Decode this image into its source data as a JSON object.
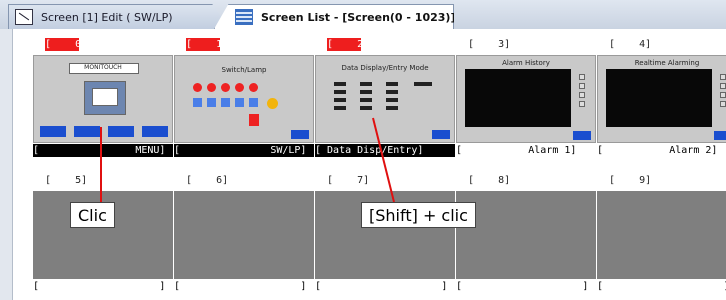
{
  "tabs": [
    {
      "label": "Screen [1] Edit (     SW/LP)"
    },
    {
      "label": "Screen List - [Screen(0 - 1023)]",
      "close": "×"
    }
  ],
  "screens": [
    {
      "number": "[    0]",
      "caption": "[                MENU]"
    },
    {
      "number": "[    1]",
      "caption": "[               SW/LP]"
    },
    {
      "number": "[    2]",
      "caption": "[ Data Disp/Entry]"
    },
    {
      "number": "[    3]",
      "caption": "[           Alarm 1]"
    },
    {
      "number": "[    4]",
      "caption": "[           Alarm 2]"
    },
    {
      "number": "[    5]",
      "caption": "[                    ]"
    },
    {
      "number": "[    6]",
      "caption": "[                    ]"
    },
    {
      "number": "[    7]",
      "caption": "[                    ]"
    },
    {
      "number": "[    8]",
      "caption": "[                    ]"
    },
    {
      "number": "[    9]",
      "caption": "[                    ]"
    }
  ],
  "thumbnails": {
    "menu_title": "MONITOUCH",
    "switch_title": "Switch/Lamp",
    "data_title": "Data Display/Entry Mode",
    "alarm_history_title": "Alarm History",
    "realtime_title": "Realtime Alarming"
  },
  "annotations": {
    "click": "Clic",
    "shift_click": "[Shift] + clic"
  },
  "colors": {
    "selected_number_bg": "#ee1e1e",
    "annotation_line": "#e01010",
    "empty_screen": "#7f7f7f"
  }
}
